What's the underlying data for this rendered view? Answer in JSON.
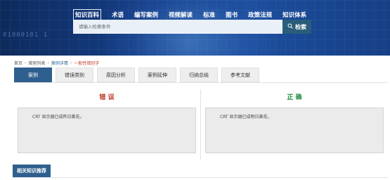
{
  "header": {
    "binary_text": "01000101 1",
    "nav": [
      {
        "label": "知识百科",
        "active": true
      },
      {
        "label": "术语"
      },
      {
        "label": "编写案例"
      },
      {
        "label": "视频解读"
      },
      {
        "label": "标准"
      },
      {
        "label": "图书"
      },
      {
        "label": "政策法规"
      },
      {
        "label": "知识体系"
      }
    ],
    "search": {
      "placeholder": "请输入检索条件",
      "button_label": "检索"
    }
  },
  "breadcrumb": {
    "items": [
      "首页",
      "案例列表",
      "案例详情",
      "一般性错别字"
    ]
  },
  "tabs": [
    {
      "label": "案例",
      "active": true
    },
    {
      "label": "错误类别"
    },
    {
      "label": "原因分析"
    },
    {
      "label": "案例延伸"
    },
    {
      "label": "归纳总结"
    },
    {
      "label": "参考文献"
    }
  ],
  "compare": {
    "wrong": {
      "title": "错 误",
      "text": "CRT 显示器已成昨日黄花。"
    },
    "right": {
      "title": "正 确",
      "text": "CRT 显示器已成明日黄花。"
    }
  },
  "related": {
    "label": "相关知识推荐"
  },
  "colors": {
    "accent": "#2f5f8e",
    "wrong": "#c0392b",
    "right": "#1e8a3c"
  }
}
